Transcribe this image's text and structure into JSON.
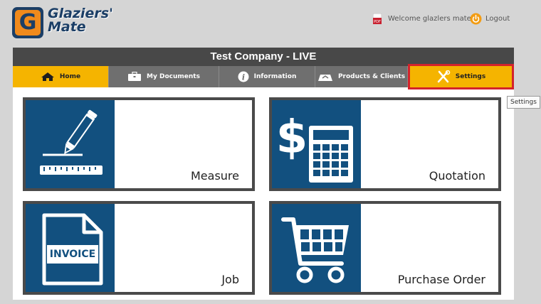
{
  "app": {
    "logo_text_line1": "Glaziers'",
    "logo_text_line2": "Mate",
    "logo_letter": "G"
  },
  "header": {
    "welcome_text": "Welcome glazlers mate",
    "logout_label": "Logout"
  },
  "title": "Test Company - LIVE",
  "nav": {
    "items": [
      {
        "label": "Home",
        "icon": "home-icon"
      },
      {
        "label": "My Documents",
        "icon": "briefcase-icon"
      },
      {
        "label": "Information",
        "icon": "info-icon"
      },
      {
        "label": "Products & Clients",
        "icon": "products-icon"
      },
      {
        "label": "Settings",
        "icon": "tools-icon"
      }
    ]
  },
  "tooltip": "Settings",
  "tiles": [
    {
      "label": "Measure",
      "icon": "measure-icon"
    },
    {
      "label": "Quotation",
      "icon": "quotation-icon"
    },
    {
      "label": "Job",
      "icon": "invoice-icon",
      "icon_text": "INVOICE"
    },
    {
      "label": "Purchase Order",
      "icon": "cart-icon"
    }
  ],
  "colors": {
    "accent": "#f5b400",
    "tile_blue": "#12507f",
    "brand_orange": "#f08a1c",
    "highlight_red": "#d4232b"
  }
}
